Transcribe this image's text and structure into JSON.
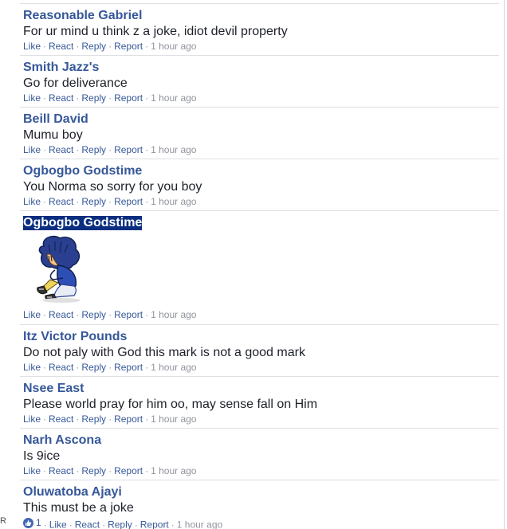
{
  "comments": [
    {
      "author": "Reasonable Gabriel",
      "text": "For ur mind u think z a joke, idiot devil property",
      "actions": [
        "Like",
        "React",
        "Reply",
        "Report"
      ],
      "time": "1 hour ago"
    },
    {
      "author": "Smith Jazz's",
      "text": "Go for deliverance",
      "actions": [
        "Like",
        "React",
        "Reply",
        "Report"
      ],
      "time": "1 hour ago"
    },
    {
      "author": "Beill David",
      "text": "Mumu boy",
      "actions": [
        "Like",
        "React",
        "Reply",
        "Report"
      ],
      "time": "1 hour ago"
    },
    {
      "author": "Ogbogbo Godstime",
      "text": "You Norma so sorry for you boy",
      "actions": [
        "Like",
        "React",
        "Reply",
        "Report"
      ],
      "time": "1 hour ago"
    },
    {
      "author": "Ogbogbo Godstime",
      "sticker": "sad-boy-sticker",
      "actions": [
        "Like",
        "React",
        "Reply",
        "Report"
      ],
      "time": "1 hour ago"
    },
    {
      "author": "Itz Victor Pounds",
      "text": "Do not paly with God this mark is not a good mark",
      "actions": [
        "Like",
        "React",
        "Reply",
        "Report"
      ],
      "time": "1 hour ago"
    },
    {
      "author": "Nsee East",
      "text": "Please world pray for him oo, may sense fall on Him",
      "actions": [
        "Like",
        "React",
        "Reply",
        "Report"
      ],
      "time": "1 hour ago"
    },
    {
      "author": "Narh Ascona",
      "text": "Is 9ice",
      "actions": [
        "Like",
        "React",
        "Reply",
        "Report"
      ],
      "time": "1 hour ago"
    },
    {
      "author": "Oluwatoba Ajayi",
      "text": "This must be a joke",
      "like_count": "1",
      "actions": [
        "Like",
        "React",
        "Reply",
        "Report"
      ],
      "time": "1 hour ago"
    }
  ],
  "edge_letter": "R",
  "colors": {
    "author": "#365899",
    "text": "#1d2129",
    "muted": "#90949c",
    "divider": "#dddfe2",
    "selection": "#0b2f80"
  }
}
